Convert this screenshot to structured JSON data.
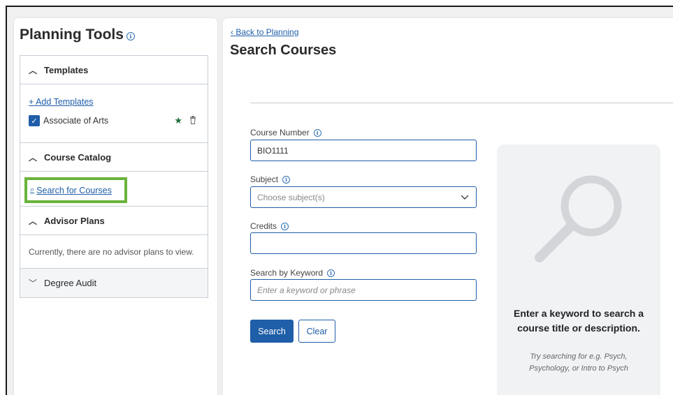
{
  "left": {
    "title": "Planning Tools",
    "info_glyph": "i",
    "templates": {
      "header": "Templates",
      "add_link": "+ Add Templates",
      "items": [
        {
          "label": "Associate of Arts",
          "checked": true
        }
      ]
    },
    "catalog": {
      "header": "Course Catalog",
      "search_link": "Search for Courses"
    },
    "advisor": {
      "header": "Advisor Plans",
      "empty_text": "Currently, there are no advisor plans to view."
    },
    "degree_audit": {
      "header": "Degree Audit"
    }
  },
  "main": {
    "back_link": "Back to Planning",
    "title": "Search Courses",
    "fields": {
      "course_number": {
        "label": "Course Number",
        "value": "BIO1111"
      },
      "subject": {
        "label": "Subject",
        "placeholder": "Choose subject(s)"
      },
      "credits": {
        "label": "Credits",
        "value": ""
      },
      "keyword": {
        "label": "Search by Keyword",
        "placeholder": "Enter a keyword or phrase"
      }
    },
    "buttons": {
      "search": "Search",
      "clear": "Clear"
    },
    "empty_state": {
      "title": "Enter a keyword to search a course title or description.",
      "hint": "Try searching for e.g. Psych, Psychology, or Intro to Psych"
    }
  },
  "colors": {
    "accent": "#1f5ea8",
    "highlight_box": "#6ab33c",
    "star": "#1e6e3c"
  },
  "icons": [
    "info-icon",
    "chevron-up-icon",
    "chevron-down-icon",
    "checkbox-checked-icon",
    "star-icon",
    "trash-icon",
    "search-icon",
    "back-chevron-icon",
    "large-magnifier-icon"
  ]
}
